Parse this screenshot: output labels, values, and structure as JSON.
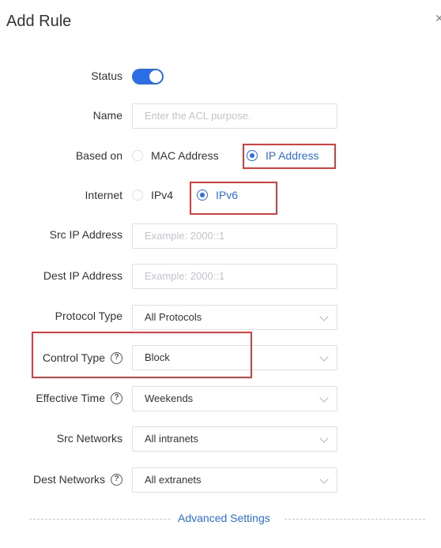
{
  "dialog": {
    "title": "Add Rule",
    "close_icon": "close-icon"
  },
  "form": {
    "status": {
      "label": "Status",
      "enabled": true
    },
    "name": {
      "label": "Name",
      "placeholder": "Enter the ACL purpose."
    },
    "based_on": {
      "label": "Based on",
      "options": [
        "MAC Address",
        "IP Address"
      ],
      "selected": "IP Address"
    },
    "internet": {
      "label": "Internet",
      "options": [
        "IPv4",
        "IPv6"
      ],
      "selected": "IPv6"
    },
    "src_ip": {
      "label": "Src IP Address",
      "placeholder": "Example: 2000::1"
    },
    "dest_ip": {
      "label": "Dest IP Address",
      "placeholder": "Example: 2000::1"
    },
    "protocol_type": {
      "label": "Protocol Type",
      "value": "All Protocols"
    },
    "control_type": {
      "label": "Control Type",
      "value": "Block"
    },
    "effective_time": {
      "label": "Effective Time",
      "value": "Weekends"
    },
    "src_networks": {
      "label": "Src Networks",
      "value": "All intranets"
    },
    "dest_networks": {
      "label": "Dest Networks",
      "value": "All extranets"
    }
  },
  "advanced": {
    "label": "Advanced Settings"
  },
  "colors": {
    "accent": "#2a6ee8",
    "highlight": "#e03b3b"
  }
}
